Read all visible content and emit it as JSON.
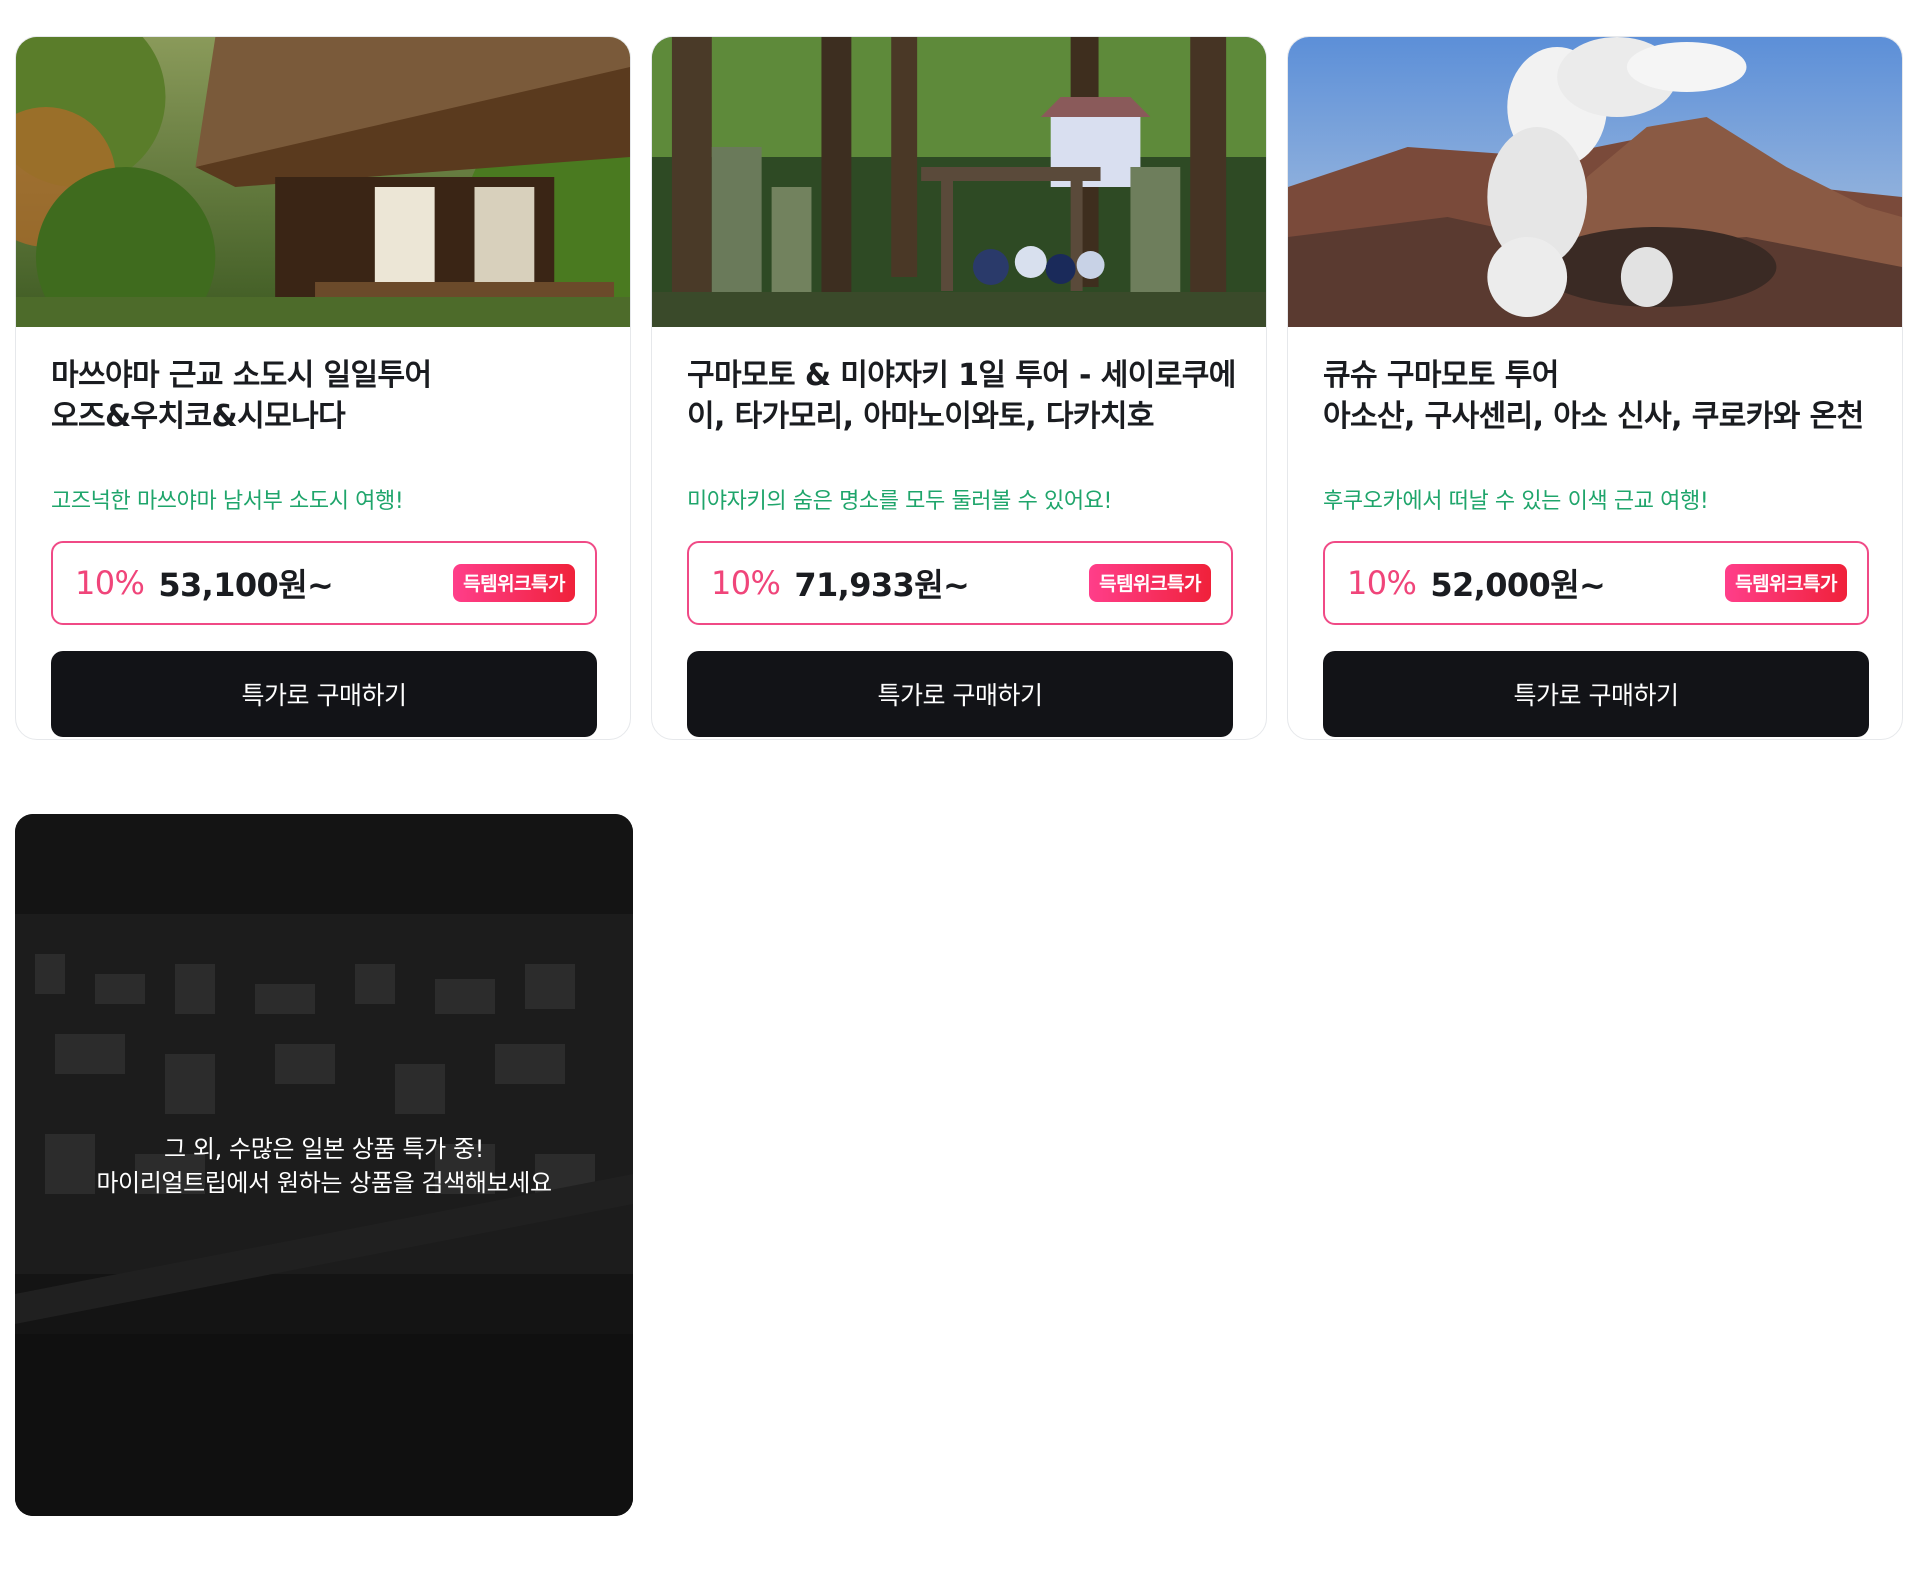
{
  "products": [
    {
      "title": "마쓰야마 근교 소도시 일일투어\n오즈&우치코&시모나다",
      "subtitle": "고즈넉한 마쓰야마 남서부 소도시 여행!",
      "discount": "10%",
      "price": "53,100원~",
      "badge": "득템위크특가",
      "button": "특가로 구매하기",
      "image": "traditional-japanese-house-garden"
    },
    {
      "title": "구마모토 & 미야자키 1일 투어 - 세이로쿠에\n이, 타가모리, 아마노이와토, 다카치호",
      "subtitle": "미야자키의 숨은 명소를 모두 둘러볼 수 있어요!",
      "discount": "10%",
      "price": "71,933원~",
      "badge": "득템위크특가",
      "button": "특가로 구매하기",
      "image": "forest-shrine-stone-lanterns"
    },
    {
      "title": "큐슈 구마모토 투어\n아소산, 구사센리, 아소 신사, 쿠로카와 온천",
      "subtitle": "후쿠오카에서 떠날 수 있는 이색 근교 여행!",
      "discount": "10%",
      "price": "52,000원~",
      "badge": "득템위크특가",
      "button": "특가로 구매하기",
      "image": "mount-aso-volcano-smoke"
    }
  ],
  "promo": {
    "line1": "그 외, 수많은 일본 상품 특가 중!",
    "line2": "마이리얼트립에서 원하는 상품을 검색해보세요",
    "image": "night-city-aerial"
  },
  "colors": {
    "accent_pink": "#f0457a",
    "subtitle_green": "#1fa56b",
    "button_dark": "#121317",
    "badge_gradient_start": "#ff3e8a",
    "badge_gradient_end": "#f0213a"
  }
}
